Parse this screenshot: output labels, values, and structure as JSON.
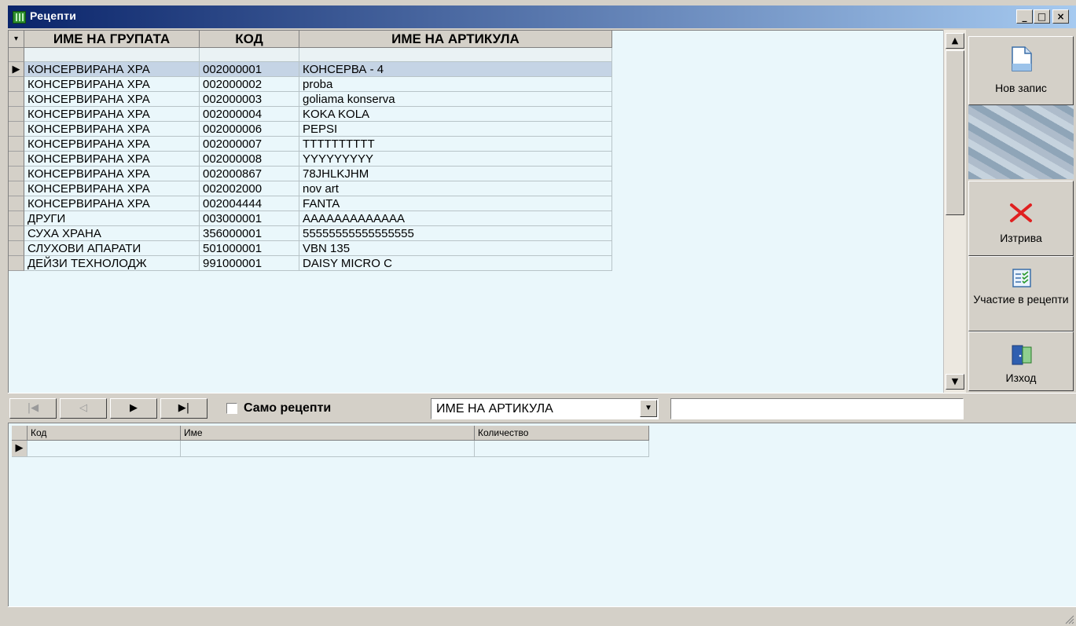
{
  "window": {
    "title": "Рецепти",
    "minimize": "_",
    "maximize": "□",
    "close": "×"
  },
  "grid": {
    "columns": [
      "ИМЕ НА ГРУПАТА",
      "КОД",
      "ИМЕ НА АРТИКУЛА"
    ],
    "rows": [
      [
        "КОНСЕРВИРАНА ХРА",
        "002000001",
        "КОНСЕРВА - 4"
      ],
      [
        "КОНСЕРВИРАНА ХРА",
        "002000002",
        "proba"
      ],
      [
        "КОНСЕРВИРАНА ХРА",
        "002000003",
        "goliama konserva"
      ],
      [
        "КОНСЕРВИРАНА ХРА",
        "002000004",
        "KOKA KOLA"
      ],
      [
        "КОНСЕРВИРАНА ХРА",
        "002000006",
        "PEPSI"
      ],
      [
        "КОНСЕРВИРАНА ХРА",
        "002000007",
        "TTTTTTTTTT"
      ],
      [
        "КОНСЕРВИРАНА ХРА",
        "002000008",
        "YYYYYYYYY"
      ],
      [
        "КОНСЕРВИРАНА ХРА",
        "002000867",
        "78JHLKJHM"
      ],
      [
        "КОНСЕРВИРАНА ХРА",
        "002002000",
        "nov art"
      ],
      [
        "КОНСЕРВИРАНА ХРА",
        "002004444",
        "FANTA"
      ],
      [
        "ДРУГИ",
        "003000001",
        "AAAAAAAAAAAAA"
      ],
      [
        "СУХА ХРАНА",
        "356000001",
        "55555555555555555"
      ],
      [
        "СЛУХОВИ АПАРАТИ",
        "501000001",
        "VBN 135"
      ],
      [
        "ДЕЙЗИ ТЕХНОЛОДЖ",
        "991000001",
        "DAISY MICRO C"
      ]
    ],
    "selected_row": 0
  },
  "side_buttons": {
    "new_record": "Нов запис",
    "delete": "Изтрива",
    "recipes_participation": "Участие в рецепти",
    "exit": "Изход"
  },
  "navigator": {
    "first": "|◀",
    "prev": "◁",
    "next": "▶",
    "last": "▶|",
    "only_recipes_label": "Само рецепти",
    "only_recipes_checked": false,
    "search_field_select": "ИМЕ НА АРТИКУЛА",
    "search_value": ""
  },
  "detail_grid": {
    "columns": [
      "Код",
      "Име",
      "Количество"
    ]
  },
  "colors": {
    "grid_bg": "#eaf7fb",
    "selected_row": "#c5d4e5",
    "title_start": "#0a246a",
    "title_end": "#a6caf0",
    "delete_icon": "#e02020"
  }
}
